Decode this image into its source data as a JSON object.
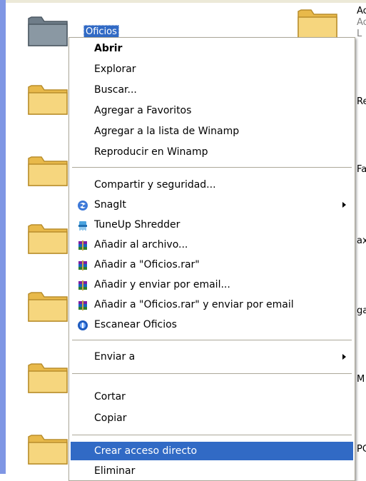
{
  "selected_folder": "Oficios",
  "side_labels": [
    "Ac",
    "Ac",
    "L",
    "Re",
    "Fa",
    "ax",
    "ga",
    "M",
    "PC"
  ],
  "menu": {
    "items": [
      {
        "label": "Abrir",
        "bold": true,
        "icon": ""
      },
      {
        "label": "Explorar",
        "icon": ""
      },
      {
        "label": "Buscar...",
        "icon": ""
      },
      {
        "label": "Agregar a Favoritos",
        "icon": ""
      },
      {
        "label": "Agregar a la lista de Winamp",
        "icon": ""
      },
      {
        "label": "Reproducir en Winamp",
        "icon": ""
      },
      {
        "label": "Compartir y seguridad...",
        "icon": ""
      },
      {
        "label": "SnagIt",
        "icon": "snagit-icon",
        "submenu": true
      },
      {
        "label": "TuneUp Shredder",
        "icon": "tuneup-shredder-icon"
      },
      {
        "label": "Añadir al archivo...",
        "icon": "winrar-icon"
      },
      {
        "label": "Añadir a \"Oficios.rar\"",
        "icon": "winrar-icon"
      },
      {
        "label": "Añadir y enviar por email...",
        "icon": "winrar-icon"
      },
      {
        "label": "Añadir a \"Oficios.rar\" y enviar por email",
        "icon": "winrar-icon"
      },
      {
        "label": "Escanear Oficios",
        "icon": "antivirus-scan-icon"
      },
      {
        "label": "Enviar a",
        "icon": "",
        "submenu": true
      },
      {
        "label": "Cortar",
        "icon": ""
      },
      {
        "label": "Copiar",
        "icon": ""
      },
      {
        "label": "Crear acceso directo",
        "icon": "",
        "highlighted": true
      },
      {
        "label": "Eliminar",
        "icon": ""
      }
    ]
  },
  "colors": {
    "selection": "#316ac5",
    "menu_border": "#aca899",
    "left_bar": "#7f96e4",
    "folder_yellow": "#f6d67e"
  }
}
